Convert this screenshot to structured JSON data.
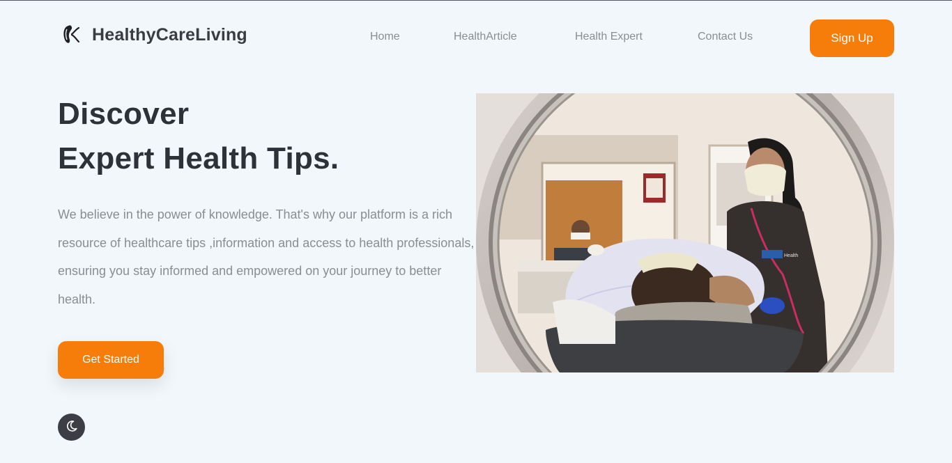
{
  "header": {
    "brand": "HealthyCareLiving",
    "logo_icon": "kidney-logo-icon",
    "nav": [
      "Home",
      "HealthArticle",
      "Health Expert",
      "Contact Us"
    ],
    "signup_label": "Sign Up"
  },
  "hero": {
    "title_line1": "Discover",
    "title_line2": "Expert Health Tips.",
    "description": "We believe in the power of knowledge. That's why our platform is a rich resource of healthcare tips ,information and access to health professionals, ensuring you stay informed and empowered on your journey to better health.",
    "cta_label": "Get Started",
    "image_badge": "Health"
  },
  "theme_toggle_icon": "moon-icon",
  "colors": {
    "accent": "#f77d0a",
    "background": "#f1f7fb",
    "heading": "#2f3138",
    "muted": "#8a8d92"
  }
}
